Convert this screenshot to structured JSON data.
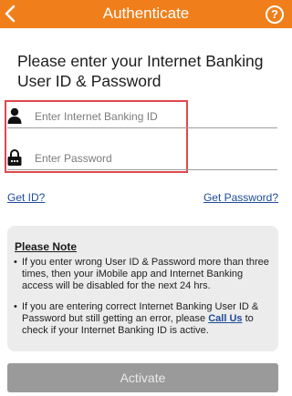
{
  "header": {
    "title": "Authenticate",
    "back_icon": "chevron-left-icon",
    "help_icon": "help-circle-icon",
    "help_glyph": "?",
    "background_color": "#f07f1b"
  },
  "form": {
    "heading": "Please enter your Internet Banking User ID & Password",
    "user_id": {
      "icon": "user-icon",
      "placeholder": "Enter Internet Banking ID",
      "value": ""
    },
    "password": {
      "icon": "lock-icon",
      "placeholder": "Enter Password",
      "value": ""
    },
    "highlight_color": "#e0474c"
  },
  "links": {
    "get_id": "Get ID?",
    "get_password": "Get Password?"
  },
  "note": {
    "title": "Please Note",
    "item1": "If you enter wrong User ID & Password more than three times, then your iMobile app and Internet Banking access will be disabled for the next 24 hrs.",
    "item2_before": "If you are entering correct Internet Banking User ID & Password but still getting an error, please",
    "item2_link": "Call Us",
    "item2_after": "to check if your Internet Banking ID is active."
  },
  "activate_label": "Activate"
}
